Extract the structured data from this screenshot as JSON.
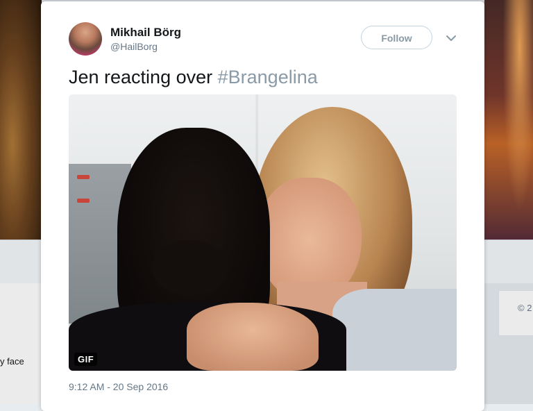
{
  "background": {
    "left_text": "y face",
    "right_text": "© 2"
  },
  "tweet": {
    "display_name": "Mikhail Börg",
    "handle": "@HailBorg",
    "follow_label": "Follow",
    "text_main": "Jen reacting over ",
    "hashtag": "#Brangelina",
    "media_badge": "GIF",
    "timestamp": "9:12 AM - 20 Sep 2016"
  },
  "icons": {
    "more": "chevron-down-icon",
    "avatar": "user-avatar"
  },
  "colors": {
    "hashtag": "#8a9aa7",
    "follow_border": "#c4d3df",
    "meta_text": "#657786",
    "primary_text": "#14171a"
  }
}
